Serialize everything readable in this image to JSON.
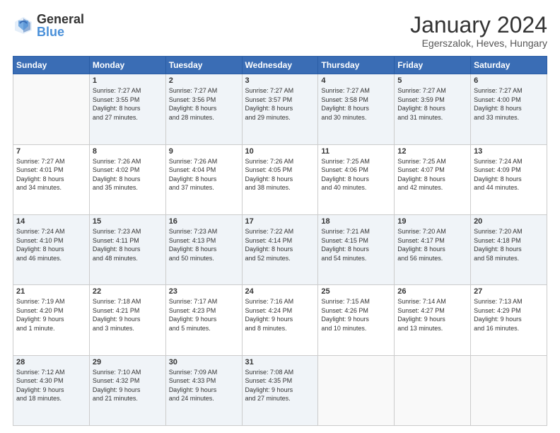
{
  "header": {
    "logo_general": "General",
    "logo_blue": "Blue",
    "month_title": "January 2024",
    "location": "Egerszalok, Heves, Hungary"
  },
  "days_of_week": [
    "Sunday",
    "Monday",
    "Tuesday",
    "Wednesday",
    "Thursday",
    "Friday",
    "Saturday"
  ],
  "weeks": [
    [
      {
        "num": "",
        "info": ""
      },
      {
        "num": "1",
        "info": "Sunrise: 7:27 AM\nSunset: 3:55 PM\nDaylight: 8 hours\nand 27 minutes."
      },
      {
        "num": "2",
        "info": "Sunrise: 7:27 AM\nSunset: 3:56 PM\nDaylight: 8 hours\nand 28 minutes."
      },
      {
        "num": "3",
        "info": "Sunrise: 7:27 AM\nSunset: 3:57 PM\nDaylight: 8 hours\nand 29 minutes."
      },
      {
        "num": "4",
        "info": "Sunrise: 7:27 AM\nSunset: 3:58 PM\nDaylight: 8 hours\nand 30 minutes."
      },
      {
        "num": "5",
        "info": "Sunrise: 7:27 AM\nSunset: 3:59 PM\nDaylight: 8 hours\nand 31 minutes."
      },
      {
        "num": "6",
        "info": "Sunrise: 7:27 AM\nSunset: 4:00 PM\nDaylight: 8 hours\nand 33 minutes."
      }
    ],
    [
      {
        "num": "7",
        "info": "Sunrise: 7:27 AM\nSunset: 4:01 PM\nDaylight: 8 hours\nand 34 minutes."
      },
      {
        "num": "8",
        "info": "Sunrise: 7:26 AM\nSunset: 4:02 PM\nDaylight: 8 hours\nand 35 minutes."
      },
      {
        "num": "9",
        "info": "Sunrise: 7:26 AM\nSunset: 4:04 PM\nDaylight: 8 hours\nand 37 minutes."
      },
      {
        "num": "10",
        "info": "Sunrise: 7:26 AM\nSunset: 4:05 PM\nDaylight: 8 hours\nand 38 minutes."
      },
      {
        "num": "11",
        "info": "Sunrise: 7:25 AM\nSunset: 4:06 PM\nDaylight: 8 hours\nand 40 minutes."
      },
      {
        "num": "12",
        "info": "Sunrise: 7:25 AM\nSunset: 4:07 PM\nDaylight: 8 hours\nand 42 minutes."
      },
      {
        "num": "13",
        "info": "Sunrise: 7:24 AM\nSunset: 4:09 PM\nDaylight: 8 hours\nand 44 minutes."
      }
    ],
    [
      {
        "num": "14",
        "info": "Sunrise: 7:24 AM\nSunset: 4:10 PM\nDaylight: 8 hours\nand 46 minutes."
      },
      {
        "num": "15",
        "info": "Sunrise: 7:23 AM\nSunset: 4:11 PM\nDaylight: 8 hours\nand 48 minutes."
      },
      {
        "num": "16",
        "info": "Sunrise: 7:23 AM\nSunset: 4:13 PM\nDaylight: 8 hours\nand 50 minutes."
      },
      {
        "num": "17",
        "info": "Sunrise: 7:22 AM\nSunset: 4:14 PM\nDaylight: 8 hours\nand 52 minutes."
      },
      {
        "num": "18",
        "info": "Sunrise: 7:21 AM\nSunset: 4:15 PM\nDaylight: 8 hours\nand 54 minutes."
      },
      {
        "num": "19",
        "info": "Sunrise: 7:20 AM\nSunset: 4:17 PM\nDaylight: 8 hours\nand 56 minutes."
      },
      {
        "num": "20",
        "info": "Sunrise: 7:20 AM\nSunset: 4:18 PM\nDaylight: 8 hours\nand 58 minutes."
      }
    ],
    [
      {
        "num": "21",
        "info": "Sunrise: 7:19 AM\nSunset: 4:20 PM\nDaylight: 9 hours\nand 1 minute."
      },
      {
        "num": "22",
        "info": "Sunrise: 7:18 AM\nSunset: 4:21 PM\nDaylight: 9 hours\nand 3 minutes."
      },
      {
        "num": "23",
        "info": "Sunrise: 7:17 AM\nSunset: 4:23 PM\nDaylight: 9 hours\nand 5 minutes."
      },
      {
        "num": "24",
        "info": "Sunrise: 7:16 AM\nSunset: 4:24 PM\nDaylight: 9 hours\nand 8 minutes."
      },
      {
        "num": "25",
        "info": "Sunrise: 7:15 AM\nSunset: 4:26 PM\nDaylight: 9 hours\nand 10 minutes."
      },
      {
        "num": "26",
        "info": "Sunrise: 7:14 AM\nSunset: 4:27 PM\nDaylight: 9 hours\nand 13 minutes."
      },
      {
        "num": "27",
        "info": "Sunrise: 7:13 AM\nSunset: 4:29 PM\nDaylight: 9 hours\nand 16 minutes."
      }
    ],
    [
      {
        "num": "28",
        "info": "Sunrise: 7:12 AM\nSunset: 4:30 PM\nDaylight: 9 hours\nand 18 minutes."
      },
      {
        "num": "29",
        "info": "Sunrise: 7:10 AM\nSunset: 4:32 PM\nDaylight: 9 hours\nand 21 minutes."
      },
      {
        "num": "30",
        "info": "Sunrise: 7:09 AM\nSunset: 4:33 PM\nDaylight: 9 hours\nand 24 minutes."
      },
      {
        "num": "31",
        "info": "Sunrise: 7:08 AM\nSunset: 4:35 PM\nDaylight: 9 hours\nand 27 minutes."
      },
      {
        "num": "",
        "info": ""
      },
      {
        "num": "",
        "info": ""
      },
      {
        "num": "",
        "info": ""
      }
    ]
  ]
}
